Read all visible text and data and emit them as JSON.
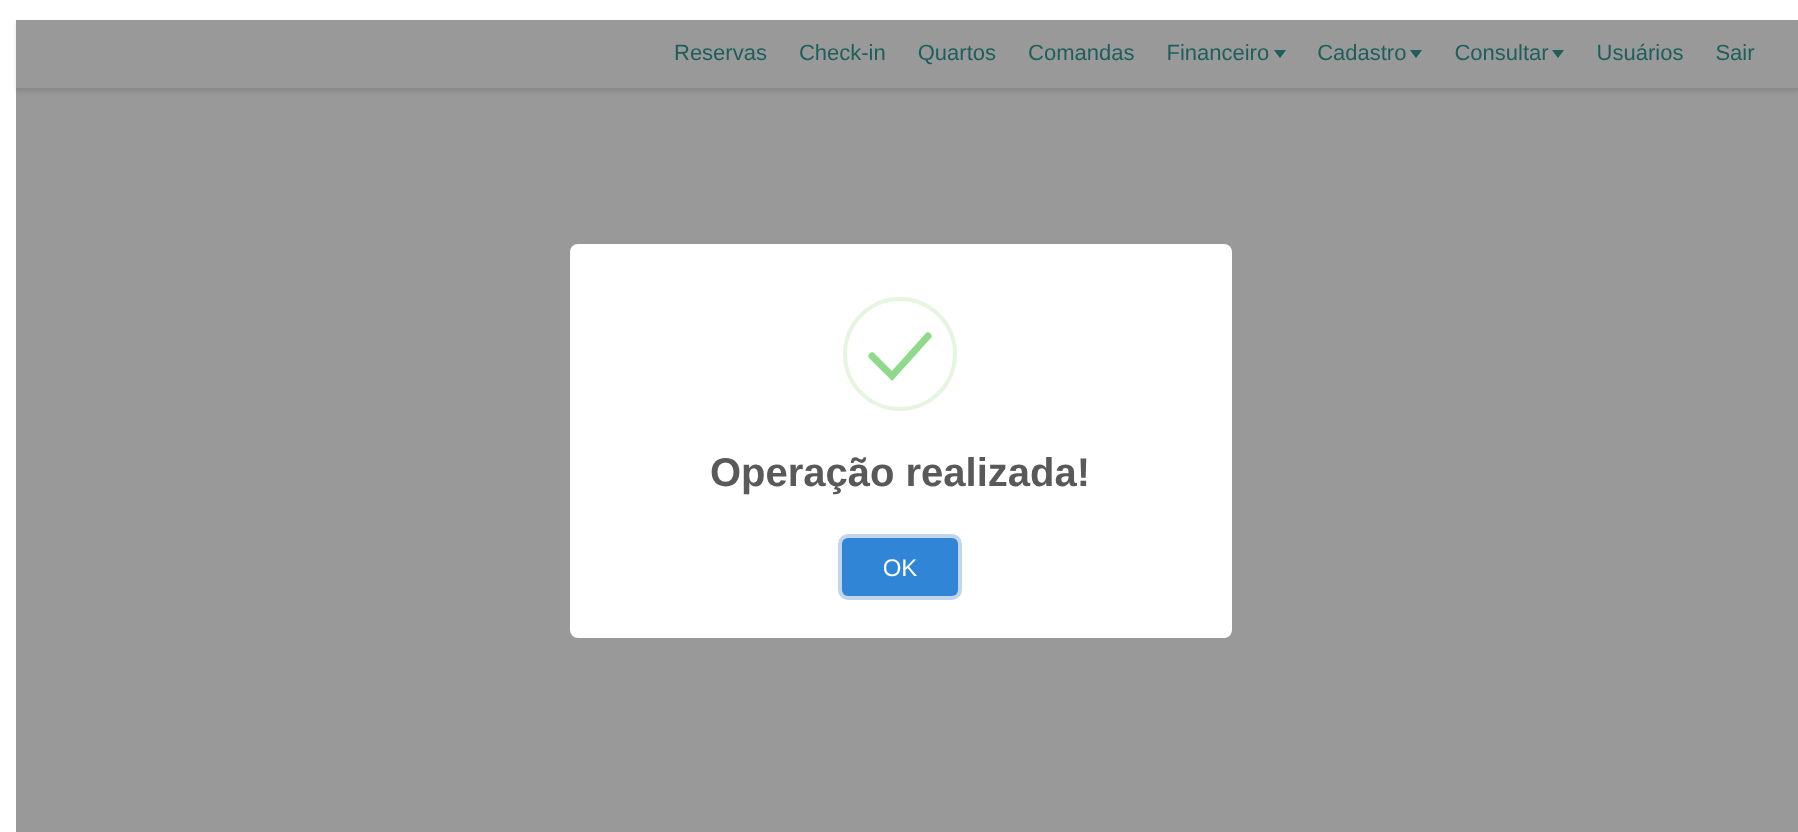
{
  "navbar": {
    "items": [
      {
        "label": "Reservas",
        "dropdown": false
      },
      {
        "label": "Check-in",
        "dropdown": false
      },
      {
        "label": "Quartos",
        "dropdown": false
      },
      {
        "label": "Comandas",
        "dropdown": false
      },
      {
        "label": "Financeiro",
        "dropdown": true
      },
      {
        "label": "Cadastro",
        "dropdown": true
      },
      {
        "label": "Consultar",
        "dropdown": true
      },
      {
        "label": "Usuários",
        "dropdown": false
      },
      {
        "label": "Sair",
        "dropdown": false
      }
    ]
  },
  "dialog": {
    "kind": "success",
    "title": "Operação realizada!",
    "button": "OK"
  }
}
